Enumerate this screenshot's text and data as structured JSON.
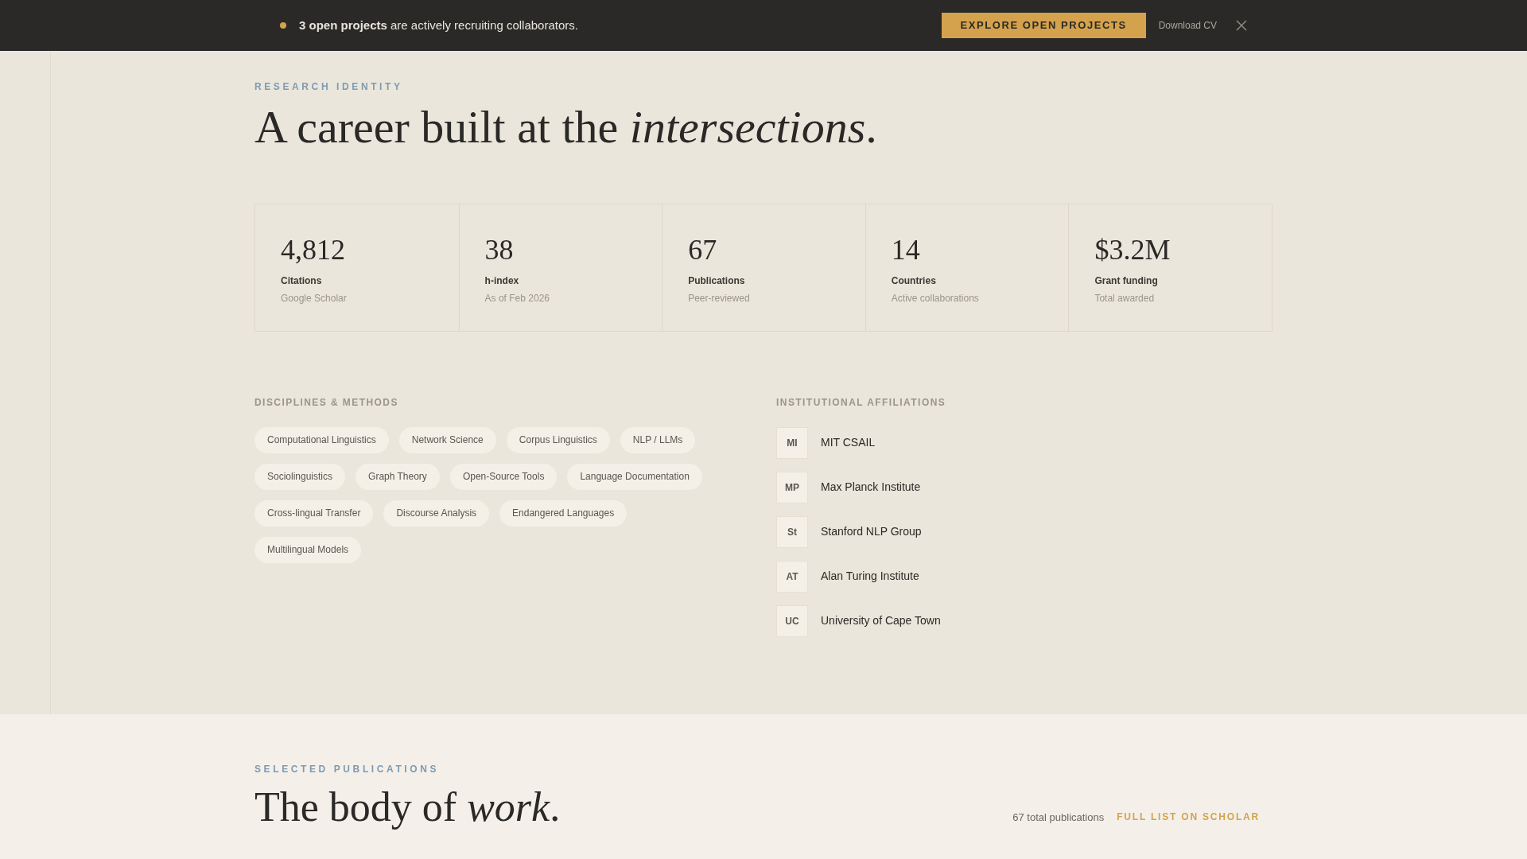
{
  "banner": {
    "message": "**3 open projects** are actively recruiting collaborators.",
    "button": "EXPLORE OPEN PROJECTS",
    "link": "Download CV"
  },
  "identity": {
    "eyebrow": "RESEARCH IDENTITY",
    "title": "A career built at the *intersections*.",
    "stats": [
      {
        "value": "4,812",
        "label": "Citations",
        "note": "Google Scholar"
      },
      {
        "value": "38",
        "label": "h-index",
        "note": "As of Feb 2026"
      },
      {
        "value": "67",
        "label": "Publications",
        "note": "Peer-reviewed"
      },
      {
        "value": "14",
        "label": "Countries",
        "note": "Active collaborations"
      },
      {
        "value": "$3.2M",
        "label": "Grant funding",
        "note": "Total awarded"
      }
    ],
    "disciplines": {
      "heading": "DISCIPLINES & METHODS",
      "tags": [
        "Computational Linguistics",
        "Network Science",
        "Corpus Linguistics",
        "NLP / LLMs",
        "Sociolinguistics",
        "Graph Theory",
        "Open-Source Tools",
        "Language Documentation",
        "Cross-lingual Transfer",
        "Discourse Analysis",
        "Endangered Languages",
        "Multilingual Models"
      ]
    },
    "affiliations": {
      "heading": "INSTITUTIONAL AFFILIATIONS",
      "items": [
        {
          "initials": "MI",
          "name": "MIT CSAIL"
        },
        {
          "initials": "MP",
          "name": "Max Planck Institute"
        },
        {
          "initials": "St",
          "name": "Stanford NLP Group"
        },
        {
          "initials": "AT",
          "name": "Alan Turing Institute"
        },
        {
          "initials": "UC",
          "name": "University of Cape Town"
        }
      ]
    }
  },
  "publications": {
    "eyebrow": "SELECTED PUBLICATIONS",
    "title": "The body of *work*.",
    "count": "67 total publications",
    "link": "FULL LIST ON SCHOLAR"
  }
}
